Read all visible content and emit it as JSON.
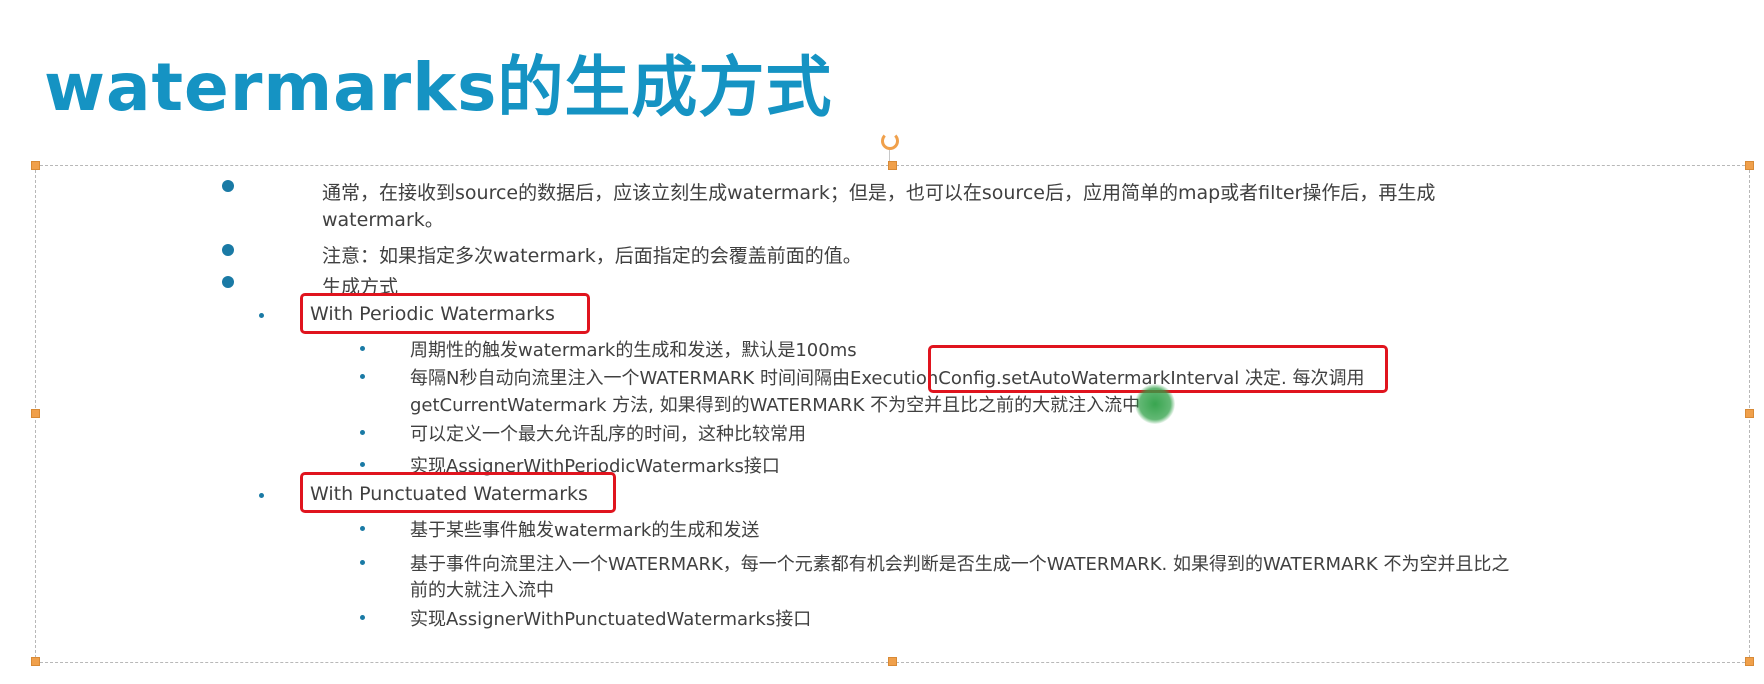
{
  "slide": {
    "title": "watermarks的生成方式",
    "bullets": [
      {
        "level1_line1": "通常，在接收到source的数据后，应该立刻生成watermark；但是，也可以在source后，应用简单的map或者filter操作后，再生成",
        "level1_line2": "watermark。"
      },
      {
        "level1": "注意：如果指定多次watermark，后面指定的会覆盖前面的值。"
      },
      {
        "level1": "生成方式"
      }
    ],
    "periodic": {
      "heading": "With Periodic Watermarks",
      "items": [
        "周期性的触发watermark的生成和发送，默认是100ms",
        "每隔N秒自动向流里注入一个WATERMARK 时间间隔由",
        "ExecutionConfig.setAutoWatermarkInterval",
        " 决定. 每次调用",
        "getCurrentWatermark 方法, 如果得到的WATERMARK 不为空并且比之前的大就注入流中",
        "可以定义一个最大允许乱序的时间，这种比较常用",
        "实现AssignerWithPeriodicWatermarks接口"
      ]
    },
    "punctuated": {
      "heading": "With Punctuated Watermarks",
      "items": [
        "基于某些事件触发watermark的生成和发送",
        "基于事件向流里注入一个WATERMARK，每一个元素都有机会判断是否生成一个WATERMARK. 如果得到的WATERMARK 不为空并且比之",
        "前的大就注入流中",
        "实现AssignerWithPunctuatedWatermarks接口"
      ]
    },
    "colors": {
      "title": "#1593c3",
      "bullet": "#1a7aa5",
      "highlight_box": "#e0141e",
      "selection_handle": "#f0a04b"
    }
  }
}
